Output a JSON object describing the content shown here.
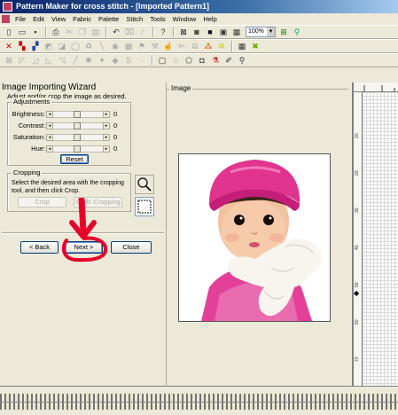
{
  "window": {
    "title": "Pattern Maker for cross stitch - [Imported Pattern1]"
  },
  "menu": [
    "File",
    "Edit",
    "View",
    "Fabric",
    "Palette",
    "Stitch",
    "Tools",
    "Window",
    "Help"
  ],
  "toolbar": {
    "zoom_value": "100%"
  },
  "wizard": {
    "title": "Image Importing Wizard",
    "instructions": "Adjust and/or crop the image as desired.",
    "adjustments": {
      "legend": "Adjustments",
      "rows": [
        {
          "label": "Brightness:",
          "value": "0",
          "position": 0.5
        },
        {
          "label": "Contrast:",
          "value": "0",
          "position": 0.5
        },
        {
          "label": "Saturation:",
          "value": "0",
          "position": 0.5
        },
        {
          "label": "Hue:",
          "value": "0",
          "position": 0.5
        }
      ],
      "reset_label": "Reset"
    },
    "cropping": {
      "legend": "Cropping",
      "text": "Select the desired area with the cropping tool, and then click Crop.",
      "crop_label": "Crop",
      "undo_label": "Undo Cropping"
    },
    "nav": {
      "back_label": "< Back",
      "next_label": "Next >",
      "close_label": "Close"
    }
  },
  "image_panel": {
    "legend": "Image"
  },
  "grid_panel": {
    "ruler_left_numbers": [
      "10",
      "20",
      "30",
      "40",
      "50",
      "60",
      "70",
      "80"
    ]
  }
}
